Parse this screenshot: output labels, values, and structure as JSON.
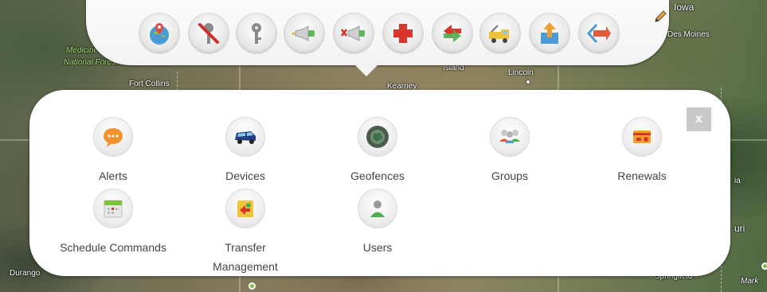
{
  "map": {
    "labels": {
      "medicine_bow": "Medicine Bow",
      "national_forest": "National Forest",
      "fort_collins": "Fort Collins",
      "kearney": "Kearney",
      "island": "Island",
      "lincoln": "Lincoln",
      "iowa_fragment": "Iowa",
      "des_moines": "Des Moines",
      "durango": "Durango",
      "springfield": "Springfield",
      "mark": "Mark",
      "souri_fragment": "uri",
      "ia_fragment": "ia"
    }
  },
  "toolbar": {
    "buttons": [
      {
        "name": "locate-icon"
      },
      {
        "name": "disable-key-icon"
      },
      {
        "name": "key-icon"
      },
      {
        "name": "signal-on-icon"
      },
      {
        "name": "signal-off-icon"
      },
      {
        "name": "add-icon"
      },
      {
        "name": "swap-arrows-icon"
      },
      {
        "name": "tow-truck-icon"
      },
      {
        "name": "upload-icon"
      },
      {
        "name": "code-arrows-icon"
      }
    ]
  },
  "panel": {
    "close_label": "x",
    "items": [
      {
        "label": "Alerts",
        "icon": "alerts-icon"
      },
      {
        "label": "Devices",
        "icon": "devices-icon"
      },
      {
        "label": "Geofences",
        "icon": "geofences-icon"
      },
      {
        "label": "Groups",
        "icon": "groups-icon"
      },
      {
        "label": "Renewals",
        "icon": "renewals-icon"
      },
      {
        "label": "Schedule Commands",
        "icon": "schedule-commands-icon"
      },
      {
        "label": "Transfer Management",
        "icon": "transfer-management-icon"
      },
      {
        "label": "Users",
        "icon": "users-icon"
      }
    ]
  }
}
